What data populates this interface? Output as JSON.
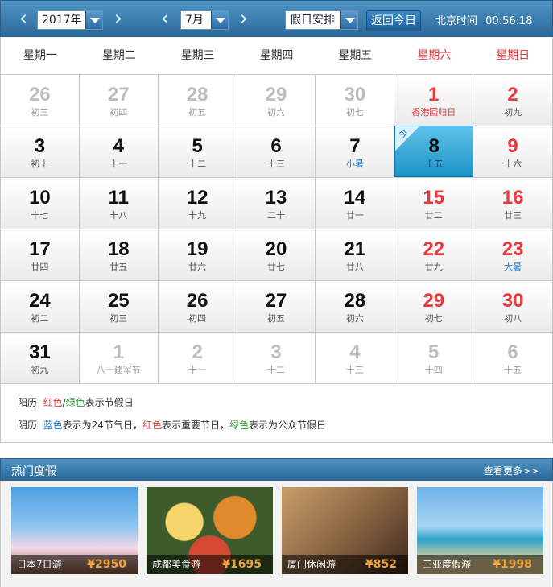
{
  "toolbar": {
    "year": "2017年",
    "month": "7月",
    "holiday_select": "假日安排",
    "today_button": "返回今日",
    "clock_label": "北京时间",
    "clock_time": "00:56:18"
  },
  "weekdays": [
    {
      "label": "星期一",
      "weekend": false
    },
    {
      "label": "星期二",
      "weekend": false
    },
    {
      "label": "星期三",
      "weekend": false
    },
    {
      "label": "星期四",
      "weekend": false
    },
    {
      "label": "星期五",
      "weekend": false
    },
    {
      "label": "星期六",
      "weekend": true
    },
    {
      "label": "星期日",
      "weekend": true
    }
  ],
  "days": [
    {
      "num": "26",
      "sub": "初三",
      "other": true
    },
    {
      "num": "27",
      "sub": "初四",
      "other": true
    },
    {
      "num": "28",
      "sub": "初五",
      "other": true
    },
    {
      "num": "29",
      "sub": "初六",
      "other": true
    },
    {
      "num": "30",
      "sub": "初七",
      "other": true
    },
    {
      "num": "1",
      "sub": "香港回归日",
      "weekend": true,
      "festival": true
    },
    {
      "num": "2",
      "sub": "初九",
      "weekend": true
    },
    {
      "num": "3",
      "sub": "初十"
    },
    {
      "num": "4",
      "sub": "十一"
    },
    {
      "num": "5",
      "sub": "十二"
    },
    {
      "num": "6",
      "sub": "十三"
    },
    {
      "num": "7",
      "sub": "小暑",
      "term": true
    },
    {
      "num": "8",
      "sub": "十五",
      "today": true,
      "today_tag": "今"
    },
    {
      "num": "9",
      "sub": "十六",
      "weekend": true
    },
    {
      "num": "10",
      "sub": "十七"
    },
    {
      "num": "11",
      "sub": "十八"
    },
    {
      "num": "12",
      "sub": "十九"
    },
    {
      "num": "13",
      "sub": "二十"
    },
    {
      "num": "14",
      "sub": "廿一"
    },
    {
      "num": "15",
      "sub": "廿二",
      "weekend": true
    },
    {
      "num": "16",
      "sub": "廿三",
      "weekend": true
    },
    {
      "num": "17",
      "sub": "廿四"
    },
    {
      "num": "18",
      "sub": "廿五"
    },
    {
      "num": "19",
      "sub": "廿六"
    },
    {
      "num": "20",
      "sub": "廿七"
    },
    {
      "num": "21",
      "sub": "廿八"
    },
    {
      "num": "22",
      "sub": "廿九",
      "weekend": true
    },
    {
      "num": "23",
      "sub": "大暑",
      "weekend": true,
      "term": true
    },
    {
      "num": "24",
      "sub": "初二"
    },
    {
      "num": "25",
      "sub": "初三"
    },
    {
      "num": "26",
      "sub": "初四"
    },
    {
      "num": "27",
      "sub": "初五"
    },
    {
      "num": "28",
      "sub": "初六"
    },
    {
      "num": "29",
      "sub": "初七",
      "weekend": true
    },
    {
      "num": "30",
      "sub": "初八",
      "weekend": true
    },
    {
      "num": "31",
      "sub": "初九"
    },
    {
      "num": "1",
      "sub": "八一建军节",
      "other": true
    },
    {
      "num": "2",
      "sub": "十一",
      "other": true
    },
    {
      "num": "3",
      "sub": "十二",
      "other": true
    },
    {
      "num": "4",
      "sub": "十三",
      "other": true
    },
    {
      "num": "5",
      "sub": "十四",
      "other": true
    },
    {
      "num": "6",
      "sub": "十五",
      "other": true
    }
  ],
  "legend": {
    "line1_prefix": "阳历",
    "line1_red": "红色",
    "line1_slash": "/",
    "line1_green": "绿色",
    "line1_suffix": "表示节假日",
    "line2_prefix": "阴历",
    "line2_blue": "蓝色",
    "line2_mid1": "表示为24节气日，",
    "line2_red": "红色",
    "line2_mid2": "表示重要节日，",
    "line2_green": "绿色",
    "line2_suffix": "表示为公众节假日"
  },
  "hot": {
    "title": "热门度假",
    "more": "查看更多>>",
    "promos": [
      {
        "name": "日本7日游",
        "price": "¥2950"
      },
      {
        "name": "成都美食游",
        "price": "¥1695"
      },
      {
        "name": "厦门休闲游",
        "price": "¥852"
      },
      {
        "name": "三亚度假游",
        "price": "¥1998"
      }
    ]
  }
}
